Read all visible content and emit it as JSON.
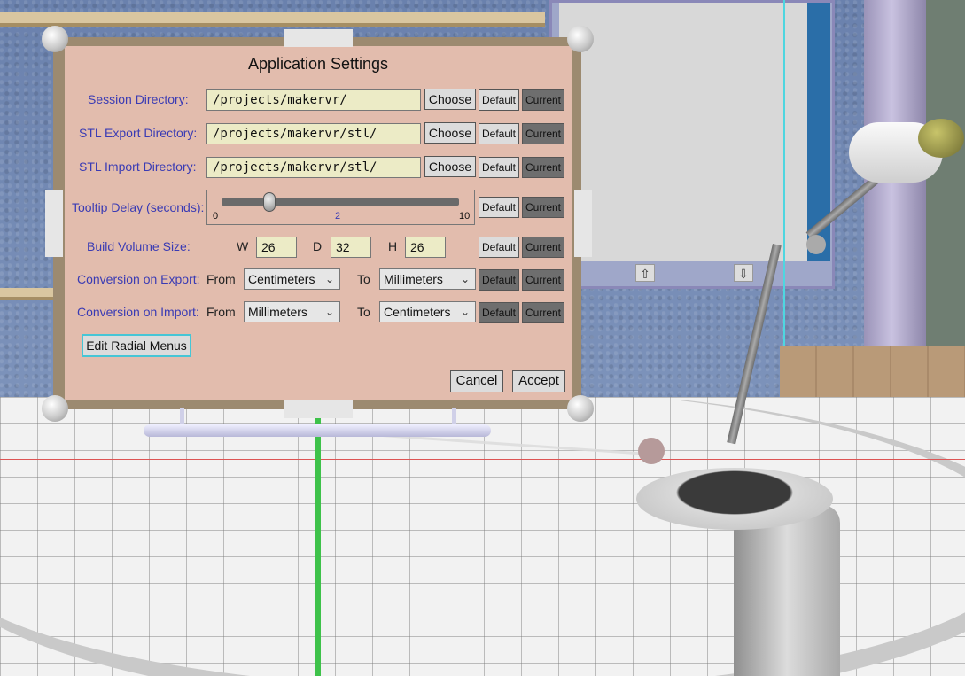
{
  "dialog": {
    "title": "Application Settings",
    "rows": {
      "session": {
        "label": "Session Directory:",
        "value": "/projects/makervr/"
      },
      "stl_export": {
        "label": "STL Export Directory:",
        "value": "/projects/makervr/stl/"
      },
      "stl_import": {
        "label": "STL Import Directory:",
        "value": "/projects/makervr/stl/"
      }
    },
    "choose_label": "Choose",
    "default_label": "Default",
    "current_label": "Current",
    "tooltip": {
      "label": "Tooltip Delay (seconds):",
      "min": "0",
      "max": "10",
      "value": "2",
      "value_fraction": 0.2
    },
    "build_volume": {
      "label": "Build Volume Size:",
      "w_label": "W",
      "w_value": "26",
      "d_label": "D",
      "d_value": "32",
      "h_label": "H",
      "h_value": "26"
    },
    "conversion_export": {
      "label": "Conversion on Export:",
      "from_label": "From",
      "from_value": "Centimeters",
      "to_label": "To",
      "to_value": "Millimeters"
    },
    "conversion_import": {
      "label": "Conversion on Import:",
      "from_label": "From",
      "from_value": "Millimeters",
      "to_label": "To",
      "to_value": "Centimeters"
    },
    "edit_radial_label": "Edit Radial Menus",
    "cancel_label": "Cancel",
    "accept_label": "Accept"
  },
  "back_panel": {
    "up_arrow": "⇧",
    "down_arrow": "⇩"
  },
  "colors": {
    "panel": "#e2bcad",
    "label_blue": "#3a3bb4",
    "field": "#ecebc6",
    "focus_ring": "#45c6d6"
  }
}
